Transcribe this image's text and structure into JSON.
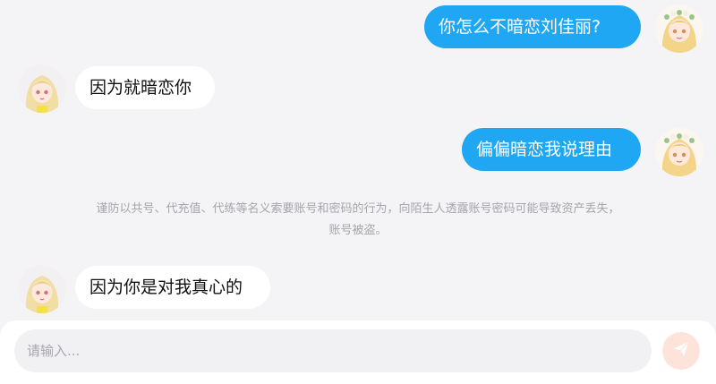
{
  "messages": [
    {
      "sender": "me",
      "text": "你怎么不暗恋刘佳丽?"
    },
    {
      "sender": "bot",
      "text": "因为就暗恋你"
    },
    {
      "sender": "me",
      "text": "偏偏暗恋我说理由"
    },
    {
      "sender": "bot",
      "text": "因为你是对我真心的"
    }
  ],
  "notice": {
    "line1": "谨防以共号、代充值、代练等名义索要账号和密码的行为，向陌生人透露账号密码可能导致资产丢失，",
    "line2": "账号被盗。"
  },
  "composer": {
    "placeholder": "请输入..."
  },
  "colors": {
    "outgoing_bubble": "#1fa7f3",
    "incoming_bubble": "#ffffff",
    "background": "#f4f4f6",
    "send_button": "#fde3da",
    "send_icon": "#ffffff"
  },
  "icons": {
    "send": "paper-plane-icon",
    "user_avatar": "blonde-girl-flower-crown-avatar",
    "bot_avatar": "blonde-girl-avatar"
  }
}
